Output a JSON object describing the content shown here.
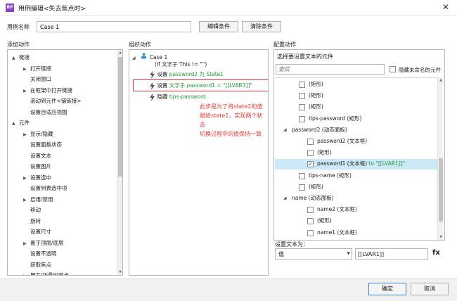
{
  "window": {
    "app_icon_text": "RP",
    "title": "用例编辑<失去焦点时>",
    "close_glyph": "✕"
  },
  "case": {
    "name_label": "用例名称",
    "name_value": "Case 1",
    "edit_condition": "编辑条件",
    "clear_condition": "清除条件"
  },
  "sections": {
    "add_action": "添加动作",
    "organize_action": "组织动作",
    "configure_action": "配置动作"
  },
  "actions_tree": [
    {
      "label": "链接",
      "level": 0,
      "expand": "▲"
    },
    {
      "label": "打开链接",
      "level": 1,
      "expand": "▶"
    },
    {
      "label": "关闭窗口",
      "level": 1,
      "expand": ""
    },
    {
      "label": "在框架中打开链接",
      "level": 1,
      "expand": "▶"
    },
    {
      "label": "滚动到元件<锚链接>",
      "level": 1,
      "expand": ""
    },
    {
      "label": "设置自适应视图",
      "level": 1,
      "expand": ""
    },
    {
      "label": "元件",
      "level": 0,
      "expand": "▲"
    },
    {
      "label": "显示/隐藏",
      "level": 1,
      "expand": "▶"
    },
    {
      "label": "设置面板状态",
      "level": 1,
      "expand": ""
    },
    {
      "label": "设置文本",
      "level": 1,
      "expand": ""
    },
    {
      "label": "设置图片",
      "level": 1,
      "expand": ""
    },
    {
      "label": "设置选中",
      "level": 1,
      "expand": "▶"
    },
    {
      "label": "设置列表选中项",
      "level": 1,
      "expand": ""
    },
    {
      "label": "启用/禁用",
      "level": 1,
      "expand": "▶"
    },
    {
      "label": "移动",
      "level": 1,
      "expand": ""
    },
    {
      "label": "旋转",
      "level": 1,
      "expand": ""
    },
    {
      "label": "设置尺寸",
      "level": 1,
      "expand": ""
    },
    {
      "label": "置于顶层/底层",
      "level": 1,
      "expand": "▶"
    },
    {
      "label": "设置不透明",
      "level": 1,
      "expand": ""
    },
    {
      "label": "获取焦点",
      "level": 1,
      "expand": ""
    },
    {
      "label": "展开/折叠树节点",
      "level": 1,
      "expand": "▶"
    }
  ],
  "organize": {
    "case_label": "Case 1",
    "condition": "(If 文字于 This != \"\")",
    "actions": [
      {
        "verb": "设置",
        "detail": "password2 为 State1"
      },
      {
        "verb": "设置",
        "detail": "文字于 password1 = \"[[LVAR1]]\""
      },
      {
        "verb": "隐藏",
        "detail": "tips-password"
      }
    ],
    "annotation_lines": [
      "此步是为了将state2的值",
      "赋给state1，实现两个状态",
      "切换过程中的值保持一致"
    ]
  },
  "configure": {
    "select_widget_label": "选择要设置文本的元件",
    "search_placeholder": "查找",
    "hide_unnamed_label": "隐藏未命名的元件",
    "widgets": [
      {
        "label": "(矩形)",
        "level": 2,
        "checked": false,
        "expand": ""
      },
      {
        "label": "(矩形)",
        "level": 2,
        "checked": false,
        "expand": ""
      },
      {
        "label": "(矩形)",
        "level": 2,
        "checked": false,
        "expand": ""
      },
      {
        "label": "tips-password (矩形)",
        "level": 2,
        "checked": false,
        "expand": ""
      },
      {
        "label": "password2 (动态面板)",
        "level": 1,
        "checked": null,
        "expand": "◢"
      },
      {
        "label": "password2 (文本框)",
        "level": 3,
        "checked": false,
        "expand": ""
      },
      {
        "label": "(矩形)",
        "level": 3,
        "checked": false,
        "expand": ""
      },
      {
        "label": "password1 (文本框)",
        "suffix": "to \"[[LVAR1]]\"",
        "level": 3,
        "checked": true,
        "expand": "",
        "highlight": true
      },
      {
        "label": "tips-name (矩形)",
        "level": 2,
        "checked": false,
        "expand": ""
      },
      {
        "label": "(矩形)",
        "level": 2,
        "checked": false,
        "expand": ""
      },
      {
        "label": "name (动态面板)",
        "level": 1,
        "checked": null,
        "expand": "◢"
      },
      {
        "label": "name2 (文本框)",
        "level": 3,
        "checked": false,
        "expand": ""
      },
      {
        "label": "(矩形)",
        "level": 3,
        "checked": false,
        "expand": ""
      },
      {
        "label": "name1 (文本框)",
        "level": 3,
        "checked": false,
        "expand": ""
      }
    ],
    "set_text_label": "设置文本为：",
    "value_type": "值",
    "value_input": "[[LVAR1]]",
    "fx_label": "fx"
  },
  "footer": {
    "ok": "确定",
    "cancel": "取消"
  },
  "colors": {
    "accent_green": "#1f9a3a",
    "annotation_red": "#e03535",
    "selection_blue": "#cce8f6",
    "app_icon_purple": "#8e44c9"
  }
}
